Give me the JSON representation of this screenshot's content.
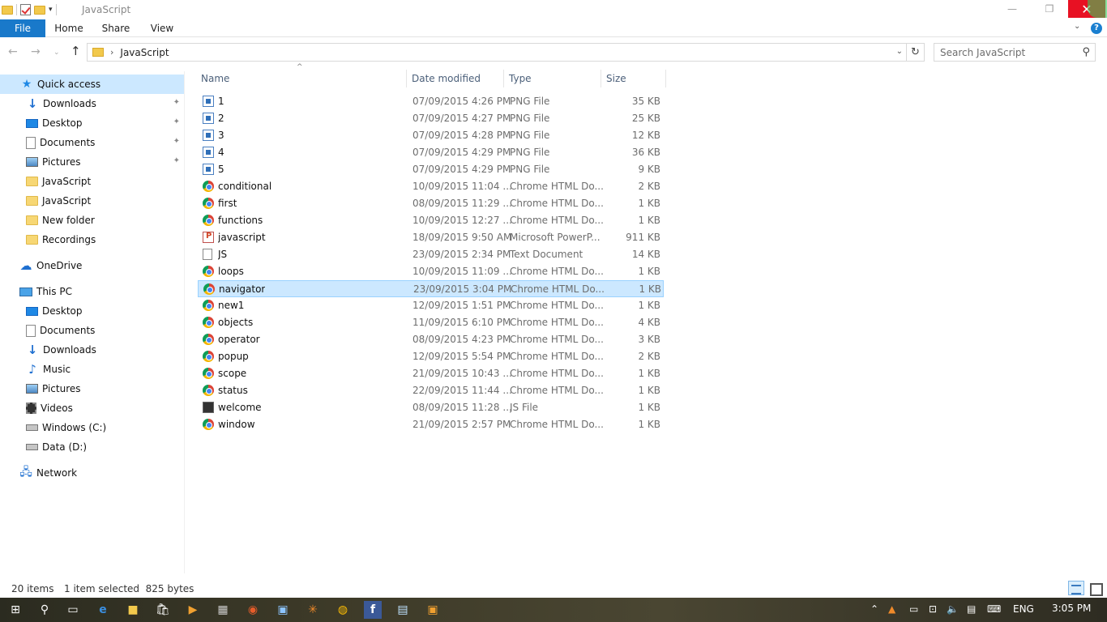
{
  "window": {
    "title": "JavaScript",
    "controls": {
      "minimize": "—",
      "maximize": "❐",
      "close": "✕"
    }
  },
  "ribbon": {
    "tabs": [
      "File",
      "Home",
      "Share",
      "View"
    ],
    "expand": "⌄",
    "help": "?"
  },
  "nav": {
    "back": "←",
    "forward": "→",
    "recent": "⌄",
    "up": "↑",
    "breadcrumb_sep": "›",
    "breadcrumb": "JavaScript",
    "dropdown": "⌄",
    "refresh": "↻",
    "search_placeholder": "Search JavaScript"
  },
  "sidebar": {
    "items": [
      {
        "label": "Quick access",
        "icon": "star-icon",
        "selected": true
      },
      {
        "label": "Downloads",
        "icon": "download-icon",
        "pinned": true
      },
      {
        "label": "Desktop",
        "icon": "desktop-icon",
        "pinned": true
      },
      {
        "label": "Documents",
        "icon": "documents-icon",
        "pinned": true
      },
      {
        "label": "Pictures",
        "icon": "pictures-icon",
        "pinned": true
      },
      {
        "label": "JavaScript",
        "icon": "folder-icon"
      },
      {
        "label": "JavaScript",
        "icon": "folder-icon"
      },
      {
        "label": "New folder",
        "icon": "folder-icon"
      },
      {
        "label": "Recordings",
        "icon": "folder-icon"
      },
      {
        "label": "OneDrive",
        "icon": "cloud-icon"
      },
      {
        "label": "This PC",
        "icon": "pc-icon"
      },
      {
        "label": "Desktop",
        "icon": "desktop-icon"
      },
      {
        "label": "Documents",
        "icon": "documents-icon"
      },
      {
        "label": "Downloads",
        "icon": "download-icon"
      },
      {
        "label": "Music",
        "icon": "music-icon"
      },
      {
        "label": "Pictures",
        "icon": "pictures-icon"
      },
      {
        "label": "Videos",
        "icon": "videos-icon"
      },
      {
        "label": "Windows (C:)",
        "icon": "drive-icon"
      },
      {
        "label": "Data (D:)",
        "icon": "drive-icon"
      },
      {
        "label": "Network",
        "icon": "network-icon"
      }
    ],
    "pin_glyph": "📌"
  },
  "filelist": {
    "columns": {
      "name": "Name",
      "date": "Date modified",
      "type": "Type",
      "size": "Size"
    },
    "sort_indicator": "^",
    "rows": [
      {
        "name": "1",
        "date": "07/09/2015 4:26 PM",
        "type": "PNG File",
        "size": "35 KB",
        "icon": "png"
      },
      {
        "name": "2",
        "date": "07/09/2015 4:27 PM",
        "type": "PNG File",
        "size": "25 KB",
        "icon": "png"
      },
      {
        "name": "3",
        "date": "07/09/2015 4:28 PM",
        "type": "PNG File",
        "size": "12 KB",
        "icon": "png"
      },
      {
        "name": "4",
        "date": "07/09/2015 4:29 PM",
        "type": "PNG File",
        "size": "36 KB",
        "icon": "png"
      },
      {
        "name": "5",
        "date": "07/09/2015 4:29 PM",
        "type": "PNG File",
        "size": "9 KB",
        "icon": "png"
      },
      {
        "name": "conditional",
        "date": "10/09/2015 11:04 ...",
        "type": "Chrome HTML Do...",
        "size": "2 KB",
        "icon": "chrome"
      },
      {
        "name": "first",
        "date": "08/09/2015 11:29 ...",
        "type": "Chrome HTML Do...",
        "size": "1 KB",
        "icon": "chrome"
      },
      {
        "name": "functions",
        "date": "10/09/2015 12:27 ...",
        "type": "Chrome HTML Do...",
        "size": "1 KB",
        "icon": "chrome"
      },
      {
        "name": "javascript",
        "date": "18/09/2015 9:50 AM",
        "type": "Microsoft PowerP...",
        "size": "911 KB",
        "icon": "ppt"
      },
      {
        "name": "JS",
        "date": "23/09/2015 2:34 PM",
        "type": "Text Document",
        "size": "14 KB",
        "icon": "txt"
      },
      {
        "name": "loops",
        "date": "10/09/2015 11:09 ...",
        "type": "Chrome HTML Do...",
        "size": "1 KB",
        "icon": "chrome"
      },
      {
        "name": "navigator",
        "date": "23/09/2015 3:04 PM",
        "type": "Chrome HTML Do...",
        "size": "1 KB",
        "icon": "chrome",
        "selected": true
      },
      {
        "name": "new1",
        "date": "12/09/2015 1:51 PM",
        "type": "Chrome HTML Do...",
        "size": "1 KB",
        "icon": "chrome"
      },
      {
        "name": "objects",
        "date": "11/09/2015 6:10 PM",
        "type": "Chrome HTML Do...",
        "size": "4 KB",
        "icon": "chrome"
      },
      {
        "name": "operator",
        "date": "08/09/2015 4:23 PM",
        "type": "Chrome HTML Do...",
        "size": "3 KB",
        "icon": "chrome"
      },
      {
        "name": "popup",
        "date": "12/09/2015 5:54 PM",
        "type": "Chrome HTML Do...",
        "size": "2 KB",
        "icon": "chrome"
      },
      {
        "name": "scope",
        "date": "21/09/2015 10:43 ...",
        "type": "Chrome HTML Do...",
        "size": "1 KB",
        "icon": "chrome"
      },
      {
        "name": "status",
        "date": "22/09/2015 11:44 ...",
        "type": "Chrome HTML Do...",
        "size": "1 KB",
        "icon": "chrome"
      },
      {
        "name": "welcome",
        "date": "08/09/2015 11:28 ...",
        "type": "JS File",
        "size": "1 KB",
        "icon": "js"
      },
      {
        "name": "window",
        "date": "21/09/2015 2:57 PM",
        "type": "Chrome HTML Do...",
        "size": "1 KB",
        "icon": "chrome"
      }
    ]
  },
  "statusbar": {
    "item_count": "20 items",
    "selection": "1 item selected  825 bytes"
  },
  "taskbar": {
    "tray_language": "ENG",
    "clock": "3:05 PM"
  },
  "colors": {
    "accent": "#1979ca",
    "selection": "#cce8ff",
    "close": "#e81123"
  }
}
